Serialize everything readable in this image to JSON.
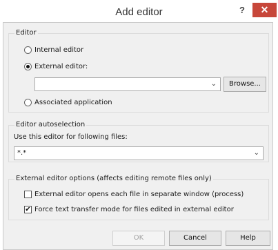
{
  "window": {
    "title": "Add editor",
    "help_glyph": "?",
    "close_glyph": "✕"
  },
  "editor_group": {
    "title": "Editor",
    "internal_label": "Internal editor",
    "external_label": "External editor:",
    "external_value": "",
    "browse_label": "Browse...",
    "associated_label": "Associated application",
    "selected": "external"
  },
  "autoselection_group": {
    "title": "Editor autoselection",
    "mask_label": "Use this editor for following files:",
    "mask_value": "*.*"
  },
  "external_options_group": {
    "title": "External editor options (affects editing remote files only)",
    "separate_window_label": "External editor opens each file in separate window (process)",
    "separate_window_checked": false,
    "force_text_label": "Force text transfer mode for files edited in external editor",
    "force_text_checked": true
  },
  "footer": {
    "ok_label": "OK",
    "cancel_label": "Cancel",
    "help_label": "Help"
  },
  "glyphs": {
    "dropdown_arrow": "⌄",
    "checkmark": "✔"
  }
}
